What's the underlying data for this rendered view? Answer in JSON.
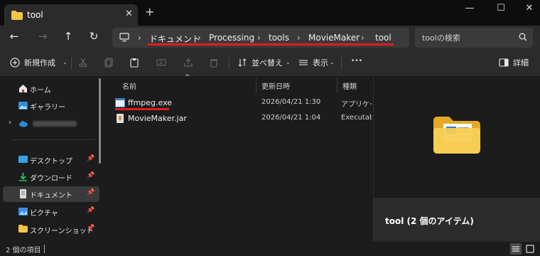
{
  "window": {
    "tab_title": "tool",
    "tab_close": "✕",
    "new_tab": "+",
    "minimize": "—",
    "maximize": "☐",
    "close": "✕"
  },
  "address": {
    "back": "←",
    "forward": "→",
    "up": "↑",
    "refresh": "↻",
    "crumbs": [
      "ドキュメント",
      "Processing",
      "tools",
      "MovieMaker",
      "tool"
    ],
    "search_placeholder": "toolの検索"
  },
  "toolbar": {
    "new_label": "新規作成",
    "sort_label": "並べ替え",
    "view_label": "表示",
    "more_label": "•••",
    "details_label": "詳細"
  },
  "sidebar": {
    "items": [
      {
        "label": "ホーム",
        "icon": "home-icon"
      },
      {
        "label": "ギャラリー",
        "icon": "gallery-icon"
      },
      {
        "label": "デスクトップ",
        "icon": "desktop-icon"
      },
      {
        "label": "ダウンロード",
        "icon": "download-icon"
      },
      {
        "label": "ドキュメント",
        "icon": "documents-icon"
      },
      {
        "label": "ピクチャ",
        "icon": "pictures-icon"
      },
      {
        "label": "スクリーンショット",
        "icon": "folder-icon"
      }
    ]
  },
  "files": {
    "columns": [
      "名前",
      "更新日時",
      "種類"
    ],
    "rows": [
      {
        "name": "ffmpeg.exe",
        "date": "2026/04/21 1:30",
        "type": "アプリケーション"
      },
      {
        "name": "MovieMaker.jar",
        "date": "2026/04/21 1:04",
        "type": "Executable"
      }
    ]
  },
  "preview": {
    "title": "tool (2 個のアイテム)"
  },
  "status": {
    "count": "2 個の項目"
  },
  "colors": {
    "accent_red": "#e11b22",
    "folder_yellow": "#f4c542",
    "background": "#1c1c1c"
  }
}
